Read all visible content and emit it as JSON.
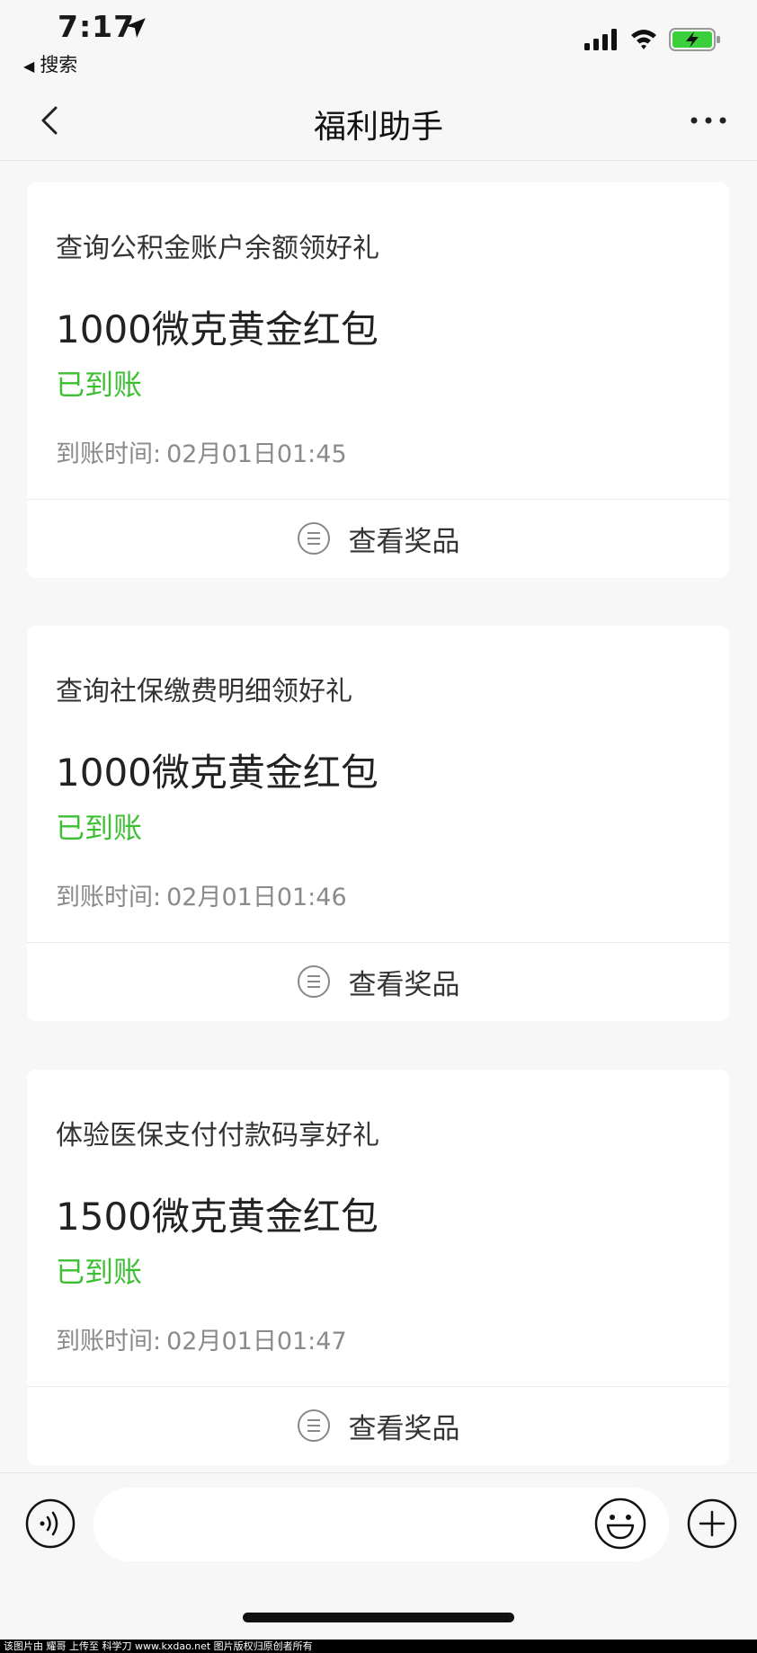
{
  "status_bar": {
    "time": "7:17",
    "back_app": "搜索"
  },
  "nav": {
    "title": "福利助手"
  },
  "cards": [
    {
      "title": "查询公积金账户余额领好礼",
      "amount": "1000微克黄金红包",
      "status": "已到账",
      "time_label": "到账时间:",
      "time_value": "02月01日01:45",
      "action": "查看奖品"
    },
    {
      "title": "查询社保缴费明细领好礼",
      "amount": "1000微克黄金红包",
      "status": "已到账",
      "time_label": "到账时间:",
      "time_value": "02月01日01:46",
      "action": "查看奖品"
    },
    {
      "title": "体验医保支付付款码享好礼",
      "amount": "1500微克黄金红包",
      "status": "已到账",
      "time_label": "到账时间:",
      "time_value": "02月01日01:47",
      "action": "查看奖品"
    }
  ],
  "watermark": "该图片由 耀哥 上传至 科学刀 www.kxdao.net 图片版权归原创者所有",
  "colors": {
    "status_green": "#3cbf32",
    "background": "#f7f7f7",
    "battery_green": "#3ccf3c"
  },
  "icons": [
    "location-arrow-icon",
    "cellular-signal-icon",
    "wifi-icon",
    "battery-charging-icon",
    "back-chevron-icon",
    "more-dots-icon",
    "list-icon",
    "voice-icon",
    "emoji-icon",
    "plus-icon"
  ]
}
